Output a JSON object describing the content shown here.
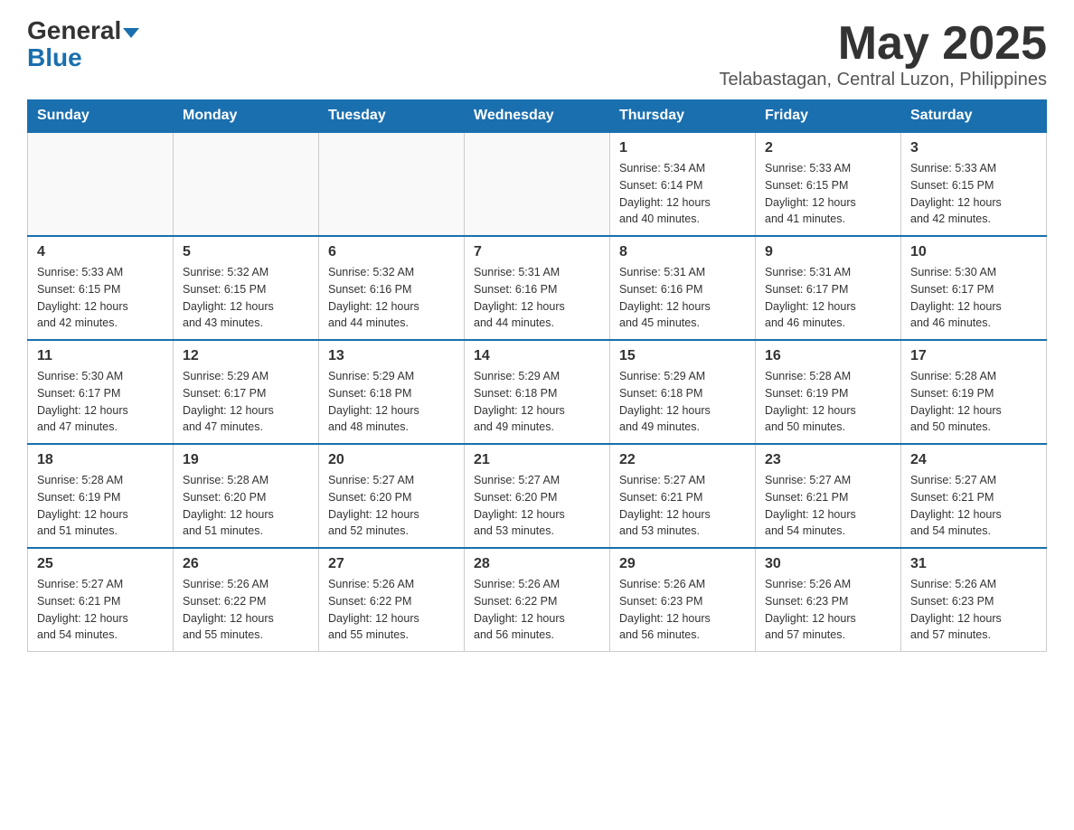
{
  "header": {
    "logo_general": "General",
    "logo_blue": "Blue",
    "month_title": "May 2025",
    "location": "Telabastagan, Central Luzon, Philippines"
  },
  "weekdays": [
    "Sunday",
    "Monday",
    "Tuesday",
    "Wednesday",
    "Thursday",
    "Friday",
    "Saturday"
  ],
  "weeks": [
    [
      {
        "day": "",
        "info": ""
      },
      {
        "day": "",
        "info": ""
      },
      {
        "day": "",
        "info": ""
      },
      {
        "day": "",
        "info": ""
      },
      {
        "day": "1",
        "info": "Sunrise: 5:34 AM\nSunset: 6:14 PM\nDaylight: 12 hours\nand 40 minutes."
      },
      {
        "day": "2",
        "info": "Sunrise: 5:33 AM\nSunset: 6:15 PM\nDaylight: 12 hours\nand 41 minutes."
      },
      {
        "day": "3",
        "info": "Sunrise: 5:33 AM\nSunset: 6:15 PM\nDaylight: 12 hours\nand 42 minutes."
      }
    ],
    [
      {
        "day": "4",
        "info": "Sunrise: 5:33 AM\nSunset: 6:15 PM\nDaylight: 12 hours\nand 42 minutes."
      },
      {
        "day": "5",
        "info": "Sunrise: 5:32 AM\nSunset: 6:15 PM\nDaylight: 12 hours\nand 43 minutes."
      },
      {
        "day": "6",
        "info": "Sunrise: 5:32 AM\nSunset: 6:16 PM\nDaylight: 12 hours\nand 44 minutes."
      },
      {
        "day": "7",
        "info": "Sunrise: 5:31 AM\nSunset: 6:16 PM\nDaylight: 12 hours\nand 44 minutes."
      },
      {
        "day": "8",
        "info": "Sunrise: 5:31 AM\nSunset: 6:16 PM\nDaylight: 12 hours\nand 45 minutes."
      },
      {
        "day": "9",
        "info": "Sunrise: 5:31 AM\nSunset: 6:17 PM\nDaylight: 12 hours\nand 46 minutes."
      },
      {
        "day": "10",
        "info": "Sunrise: 5:30 AM\nSunset: 6:17 PM\nDaylight: 12 hours\nand 46 minutes."
      }
    ],
    [
      {
        "day": "11",
        "info": "Sunrise: 5:30 AM\nSunset: 6:17 PM\nDaylight: 12 hours\nand 47 minutes."
      },
      {
        "day": "12",
        "info": "Sunrise: 5:29 AM\nSunset: 6:17 PM\nDaylight: 12 hours\nand 47 minutes."
      },
      {
        "day": "13",
        "info": "Sunrise: 5:29 AM\nSunset: 6:18 PM\nDaylight: 12 hours\nand 48 minutes."
      },
      {
        "day": "14",
        "info": "Sunrise: 5:29 AM\nSunset: 6:18 PM\nDaylight: 12 hours\nand 49 minutes."
      },
      {
        "day": "15",
        "info": "Sunrise: 5:29 AM\nSunset: 6:18 PM\nDaylight: 12 hours\nand 49 minutes."
      },
      {
        "day": "16",
        "info": "Sunrise: 5:28 AM\nSunset: 6:19 PM\nDaylight: 12 hours\nand 50 minutes."
      },
      {
        "day": "17",
        "info": "Sunrise: 5:28 AM\nSunset: 6:19 PM\nDaylight: 12 hours\nand 50 minutes."
      }
    ],
    [
      {
        "day": "18",
        "info": "Sunrise: 5:28 AM\nSunset: 6:19 PM\nDaylight: 12 hours\nand 51 minutes."
      },
      {
        "day": "19",
        "info": "Sunrise: 5:28 AM\nSunset: 6:20 PM\nDaylight: 12 hours\nand 51 minutes."
      },
      {
        "day": "20",
        "info": "Sunrise: 5:27 AM\nSunset: 6:20 PM\nDaylight: 12 hours\nand 52 minutes."
      },
      {
        "day": "21",
        "info": "Sunrise: 5:27 AM\nSunset: 6:20 PM\nDaylight: 12 hours\nand 53 minutes."
      },
      {
        "day": "22",
        "info": "Sunrise: 5:27 AM\nSunset: 6:21 PM\nDaylight: 12 hours\nand 53 minutes."
      },
      {
        "day": "23",
        "info": "Sunrise: 5:27 AM\nSunset: 6:21 PM\nDaylight: 12 hours\nand 54 minutes."
      },
      {
        "day": "24",
        "info": "Sunrise: 5:27 AM\nSunset: 6:21 PM\nDaylight: 12 hours\nand 54 minutes."
      }
    ],
    [
      {
        "day": "25",
        "info": "Sunrise: 5:27 AM\nSunset: 6:21 PM\nDaylight: 12 hours\nand 54 minutes."
      },
      {
        "day": "26",
        "info": "Sunrise: 5:26 AM\nSunset: 6:22 PM\nDaylight: 12 hours\nand 55 minutes."
      },
      {
        "day": "27",
        "info": "Sunrise: 5:26 AM\nSunset: 6:22 PM\nDaylight: 12 hours\nand 55 minutes."
      },
      {
        "day": "28",
        "info": "Sunrise: 5:26 AM\nSunset: 6:22 PM\nDaylight: 12 hours\nand 56 minutes."
      },
      {
        "day": "29",
        "info": "Sunrise: 5:26 AM\nSunset: 6:23 PM\nDaylight: 12 hours\nand 56 minutes."
      },
      {
        "day": "30",
        "info": "Sunrise: 5:26 AM\nSunset: 6:23 PM\nDaylight: 12 hours\nand 57 minutes."
      },
      {
        "day": "31",
        "info": "Sunrise: 5:26 AM\nSunset: 6:23 PM\nDaylight: 12 hours\nand 57 minutes."
      }
    ]
  ]
}
